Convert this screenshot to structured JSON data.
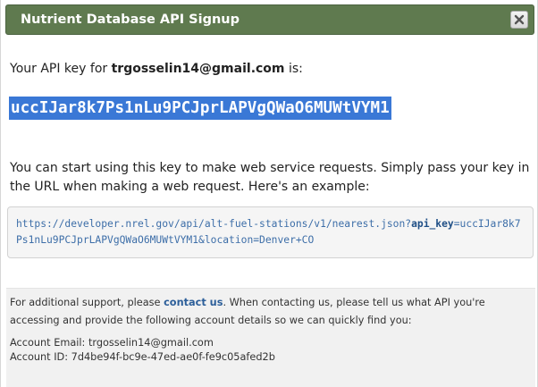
{
  "dialog": {
    "title": "Nutrient Database API Signup",
    "close_label": "×"
  },
  "key_intro": {
    "prefix": "Your API key for ",
    "email": "trgosselin14@gmail.com",
    "suffix": " is:"
  },
  "api_key": "uccIJar8k7Ps1nLu9PCJprLAPVgQWaO6MUWtVYM1",
  "instructions": "You can start using this key to make web service requests. Simply pass your key in the URL when making a web request. Here's an example:",
  "example": {
    "base_url": "https://developer.nrel.gov/api/alt-fuel-stations/v1/nearest.json?",
    "param_name": "api_key",
    "equals": "=",
    "key_value": "uccIJar8k7Ps1nLu9PCJprLAPVgQWaO6MUWtVYM1",
    "rest": "&location=Denver+CO"
  },
  "footer": {
    "support_prefix": "For additional support, please ",
    "contact_link": "contact us",
    "support_suffix": ". When contacting us, please tell us what API you're accessing and provide the following account details so we can quickly find you:",
    "account_email_label": "Account Email: ",
    "account_email": "trgosselin14@gmail.com",
    "account_id_label": "Account ID: ",
    "account_id": "7d4be94f-bc9e-47ed-ae0f-fe9c05afed2b"
  },
  "colors": {
    "titlebar": "#5f7a4f",
    "selection": "#3a78d6",
    "link": "#2d5f9a"
  },
  "icons": {
    "close": "close-icon"
  }
}
